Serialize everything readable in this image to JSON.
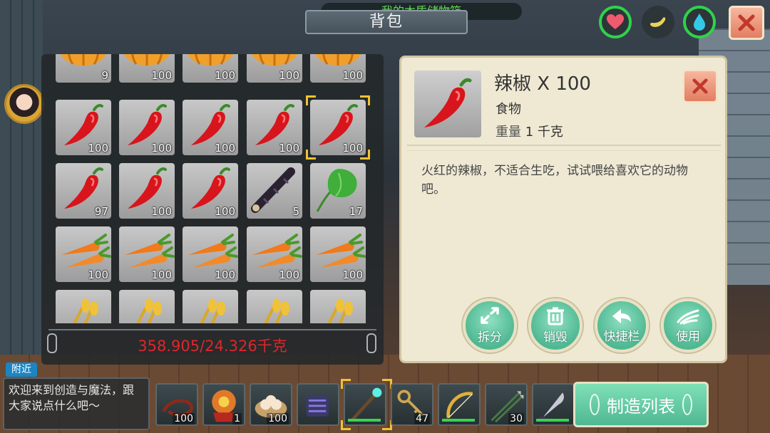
{
  "chest_title": "我的木质储物箱",
  "header_title": "背包",
  "status_icons": [
    "heart-icon",
    "hunger-icon",
    "water-drop-icon"
  ],
  "inventory": {
    "rows": [
      [
        {
          "item": "pumpkin",
          "count": "9"
        },
        {
          "item": "pumpkin",
          "count": "100"
        },
        {
          "item": "pumpkin",
          "count": "100"
        },
        {
          "item": "pumpkin",
          "count": "100"
        },
        {
          "item": "pumpkin",
          "count": "100"
        }
      ],
      [
        {
          "item": "chili",
          "count": "100"
        },
        {
          "item": "chili",
          "count": "100"
        },
        {
          "item": "chili",
          "count": "100"
        },
        {
          "item": "chili",
          "count": "100"
        },
        {
          "item": "chili",
          "count": "100",
          "selected": true
        }
      ],
      [
        {
          "item": "chili",
          "count": "97"
        },
        {
          "item": "chili",
          "count": "100"
        },
        {
          "item": "chili",
          "count": "100"
        },
        {
          "item": "bamboo",
          "count": "5"
        },
        {
          "item": "greens",
          "count": "17"
        }
      ],
      [
        {
          "item": "carrot",
          "count": "100"
        },
        {
          "item": "carrot",
          "count": "100"
        },
        {
          "item": "carrot",
          "count": "100"
        },
        {
          "item": "carrot",
          "count": "100"
        },
        {
          "item": "carrot",
          "count": "100"
        }
      ],
      [
        {
          "item": "wheat",
          "count": ""
        },
        {
          "item": "wheat",
          "count": ""
        },
        {
          "item": "wheat",
          "count": ""
        },
        {
          "item": "wheat",
          "count": ""
        },
        {
          "item": "wheat",
          "count": ""
        }
      ]
    ],
    "weight_text": "358.905/24.326千克"
  },
  "detail": {
    "name": "辣椒 X 100",
    "type": "食物",
    "weight_label": "重量",
    "weight_value": "1 千克",
    "description": "火红的辣椒，不适合生吃，试试喂给喜欢它的动物吧。",
    "actions": [
      {
        "label": "拆分",
        "icon": "split-icon"
      },
      {
        "label": "销毁",
        "icon": "trash-icon"
      },
      {
        "label": "快捷栏",
        "icon": "arrow-left-icon"
      },
      {
        "label": "使用",
        "icon": "hand-icon"
      }
    ]
  },
  "chat": {
    "tag": "附近",
    "message": "欢迎来到创造与魔法，跟大家说点什么吧～"
  },
  "hotbar": [
    {
      "item": "whip",
      "count": "100",
      "bar": false
    },
    {
      "item": "armor",
      "count": "1",
      "bar": false
    },
    {
      "item": "dumplings",
      "count": "100",
      "bar": false
    },
    {
      "item": "gauntlet",
      "count": "",
      "bar": false
    },
    {
      "item": "magic-staff",
      "count": "",
      "bar": true,
      "selected": true
    },
    {
      "item": "keys",
      "count": "47",
      "bar": false
    },
    {
      "item": "bow",
      "count": "",
      "bar": true
    },
    {
      "item": "arrows",
      "count": "30",
      "bar": false
    },
    {
      "item": "dagger",
      "count": "",
      "bar": true
    }
  ],
  "craft_button": "制造列表",
  "colors": {
    "accent_green": "#4fb893",
    "weight_red": "#e0262a",
    "selection_gold": "#f1c233",
    "close_red": "#e27e62"
  }
}
